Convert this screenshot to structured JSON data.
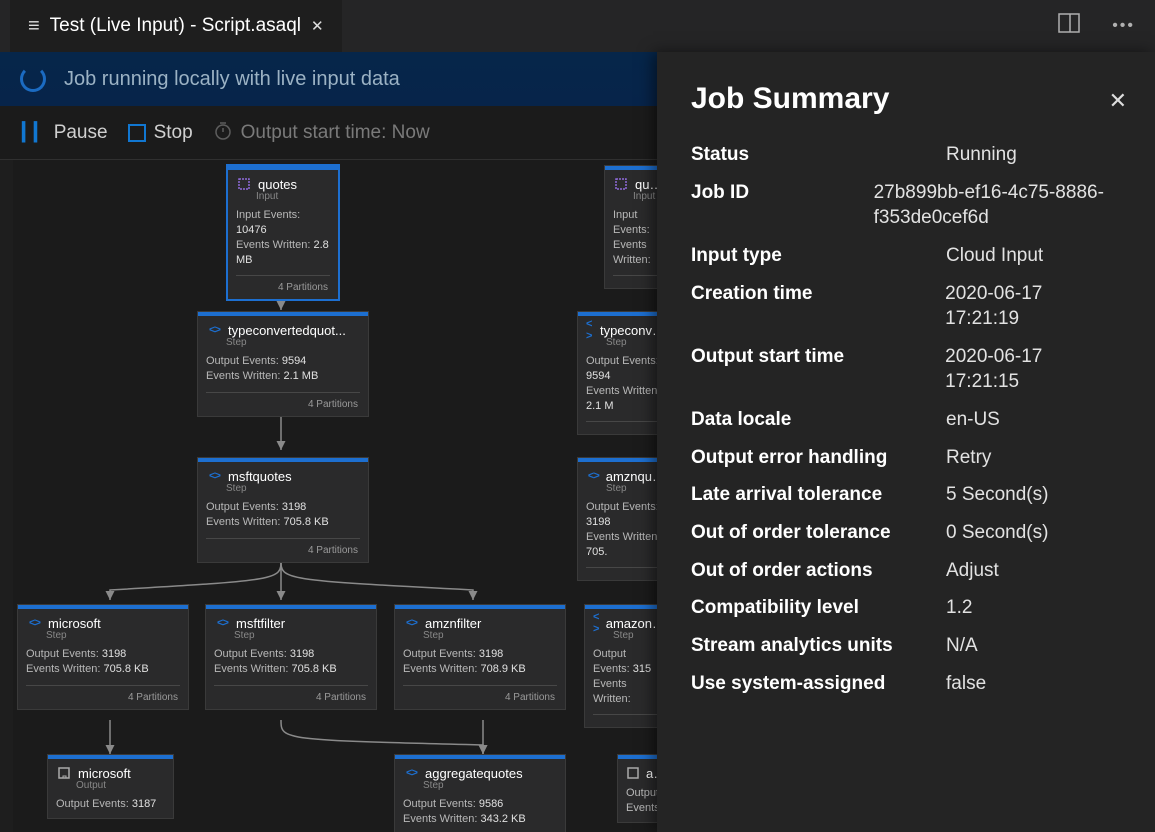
{
  "titlebar": {
    "tab_title": "Test (Live Input) - Script.asaql"
  },
  "statusbar": {
    "message": "Job running locally with live input data"
  },
  "toolbar": {
    "pause_label": "Pause",
    "stop_label": "Stop",
    "output_start_label": "Output start time: Now"
  },
  "panel": {
    "title": "Job Summary",
    "rows": [
      {
        "label": "Status",
        "value": "Running"
      },
      {
        "label": "Job ID",
        "value": "27b899bb-ef16-4c75-8886-f353de0cef6d"
      },
      {
        "label": "Input type",
        "value": "Cloud Input"
      },
      {
        "label": "Creation time",
        "value": "2020-06-17 17:21:19"
      },
      {
        "label": "Output start time",
        "value": "2020-06-17 17:21:15"
      },
      {
        "label": "Data locale",
        "value": "en-US"
      },
      {
        "label": "Output error handling",
        "value": "Retry"
      },
      {
        "label": "Late arrival tolerance",
        "value": "5 Second(s)"
      },
      {
        "label": "Out of order tolerance",
        "value": "0 Second(s)"
      },
      {
        "label": "Out of order actions",
        "value": "Adjust"
      },
      {
        "label": "Compatibility level",
        "value": "1.2"
      },
      {
        "label": "Stream analytics units",
        "value": "N/A"
      },
      {
        "label": "Use system-assigned",
        "value": "false"
      }
    ]
  },
  "nodes": {
    "quotes": {
      "title": "quotes",
      "kind": "Input",
      "input_events": "10476",
      "events_written": "2.8 MB",
      "partitions": "4 Partitions"
    },
    "quotes2": {
      "title": "qu…",
      "kind": "Input",
      "input_events": "",
      "events_written": "",
      "partitions": ""
    },
    "typeconverted": {
      "title": "typeconvertedquot...",
      "kind": "Step",
      "output_events": "9594",
      "events_written": "2.1 MB",
      "partitions": "4 Partitions"
    },
    "typeconverted2": {
      "title": "typeconv…",
      "kind": "Step",
      "output_events": "9594",
      "events_written": "2.1 M",
      "partitions": ""
    },
    "msftquotes": {
      "title": "msftquotes",
      "kind": "Step",
      "output_events": "3198",
      "events_written": "705.8 KB",
      "partitions": "4 Partitions"
    },
    "amznquotes": {
      "title": "amznqu…",
      "kind": "Step",
      "output_events": "3198",
      "events_written": "705.",
      "partitions": ""
    },
    "microsoft": {
      "title": "microsoft",
      "kind": "Step",
      "output_events": "3198",
      "events_written": "705.8 KB",
      "partitions": "4 Partitions"
    },
    "msftfilter": {
      "title": "msftfilter",
      "kind": "Step",
      "output_events": "3198",
      "events_written": "705.8 KB",
      "partitions": "4 Partitions"
    },
    "amznfilter": {
      "title": "amznfilter",
      "kind": "Step",
      "output_events": "3198",
      "events_written": "708.9 KB",
      "partitions": "4 Partitions"
    },
    "amazon": {
      "title": "amazon…",
      "kind": "Step",
      "output_events": "315",
      "events_written": "",
      "partitions": ""
    },
    "microsoft_out": {
      "title": "microsoft",
      "kind": "Output",
      "output_events": "3187",
      "events_written": "",
      "partitions": ""
    },
    "aggregatequotes": {
      "title": "aggregatequotes",
      "kind": "Step",
      "output_events": "9586",
      "events_written": "343.2 KB",
      "partitions": ""
    },
    "amazon_out": {
      "title": "a…",
      "kind": "Output",
      "output_events": "",
      "events_written": "",
      "partitions": ""
    }
  },
  "labels": {
    "input_events": "Input Events:",
    "output_events": "Output Events:",
    "events_written": "Events Written:"
  }
}
